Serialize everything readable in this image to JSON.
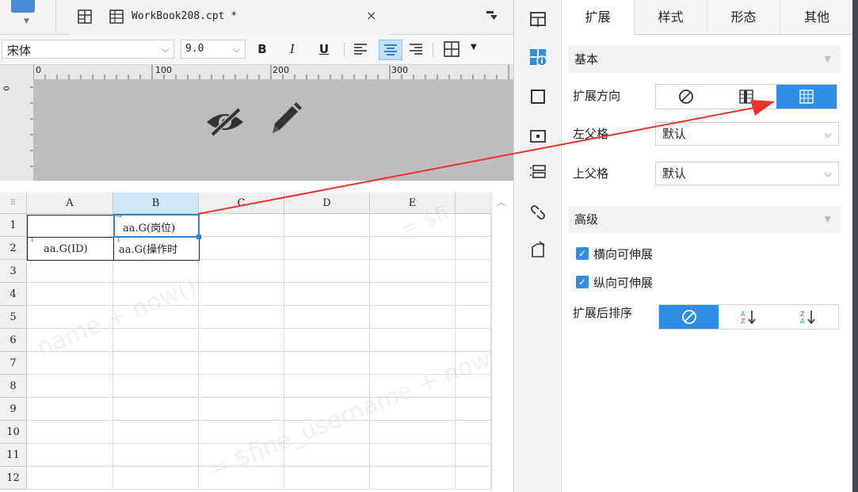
{
  "tab": {
    "title": "WorkBook208.cpt *",
    "close": "×"
  },
  "toolbar": {
    "font_name": "宋体",
    "font_size": "9.0",
    "bold": "B",
    "italic": "I",
    "underline": "U"
  },
  "ruler": {
    "ticks": [
      "0",
      "100",
      "200",
      "300"
    ]
  },
  "grid": {
    "columns": [
      "A",
      "B",
      "C",
      "D",
      "E"
    ],
    "rows": [
      "1",
      "2",
      "3",
      "4",
      "5",
      "6",
      "7",
      "8",
      "9",
      "10",
      "11",
      "12"
    ],
    "cells": {
      "b1": "aa.G(岗位)",
      "a2": "aa.G(ID)",
      "b2": "aa.G(操作时"
    },
    "watermark_1": "name + now()",
    "watermark_2": "= $fine_username + now()",
    "watermark_3": "= $fi"
  },
  "panel": {
    "tabs": [
      "扩展",
      "样式",
      "形态",
      "其他"
    ],
    "section_basic": "基本",
    "expand_direction_label": "扩展方向",
    "left_parent_label": "左父格",
    "left_parent_value": "默认",
    "top_parent_label": "上父格",
    "top_parent_value": "默认",
    "section_advanced": "高级",
    "horizontal_expand_label": "横向可伸展",
    "vertical_expand_label": "纵向可伸展",
    "sort_label": "扩展后排序"
  },
  "colors": {
    "accent": "#2f8de4",
    "arrow": "#e8342a",
    "selection": "#2f7ed8"
  }
}
